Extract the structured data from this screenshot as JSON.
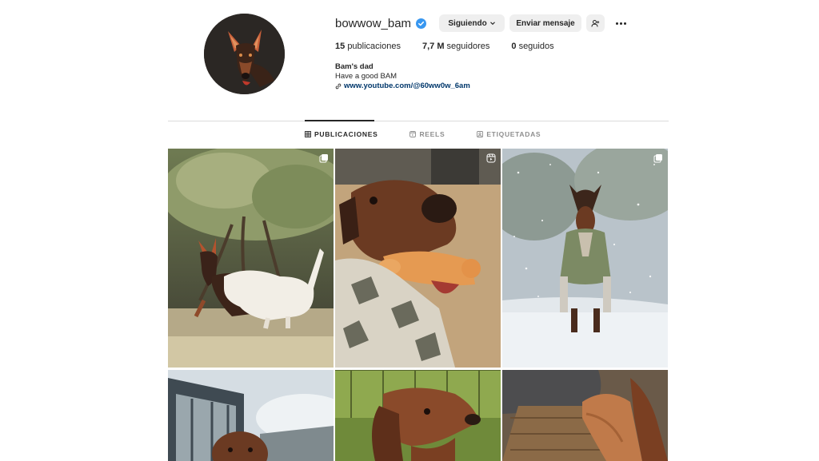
{
  "profile": {
    "username": "bowwow_bam",
    "verified": true,
    "follow_label": "Siguiendo",
    "message_label": "Enviar mensaje",
    "stats": {
      "posts_count": "15",
      "posts_label": "publicaciones",
      "followers_count": "7,7 M",
      "followers_label": "seguidores",
      "following_count": "0",
      "following_label": "seguidos"
    },
    "bio": {
      "name": "Bam's dad",
      "text": "Have a good BAM",
      "link": "www.youtube.com/@60ww0w_6am"
    }
  },
  "tabs": [
    {
      "label": "PUBLICACIONES",
      "icon": "grid-icon",
      "active": true
    },
    {
      "label": "REELS",
      "icon": "reels-icon",
      "active": false
    },
    {
      "label": "ETIQUETADAS",
      "icon": "tagged-icon",
      "active": false
    }
  ],
  "posts": [
    {
      "subject": "doberman playing with white dog near tree",
      "badge": "multi-photo-icon"
    },
    {
      "subject": "doberman holding chew bone",
      "badge": "reel-icon"
    },
    {
      "subject": "doberman in green vest in snow",
      "badge": "multi-photo-icon"
    },
    {
      "subject": "dog near glass building",
      "badge": ""
    },
    {
      "subject": "dachshund close-up",
      "badge": ""
    },
    {
      "subject": "dog paws on wooden bench",
      "badge": ""
    }
  ],
  "colors": {
    "verified": "#3897f0",
    "link": "#00376b",
    "button_bg": "#efefef",
    "divider": "#dbdbdb"
  }
}
